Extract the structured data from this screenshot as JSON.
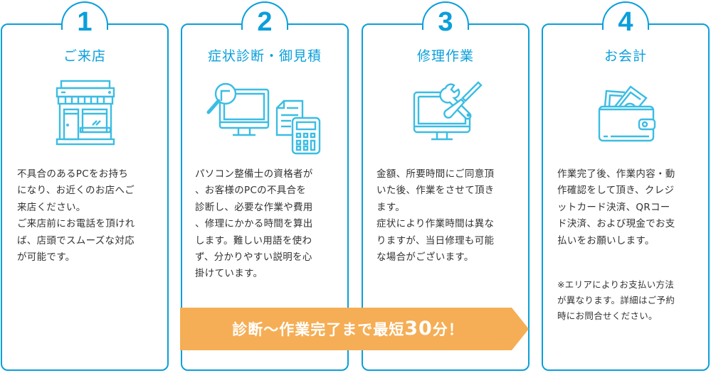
{
  "accent_color": "#0a9fdb",
  "banner_color": "#f5ae55",
  "steps": [
    {
      "number": "1",
      "title": "ご来店",
      "icon": "storefront-icon",
      "description": "不具合のあるPCをお持ち\nになり、お近くのお店へご\n来店ください。\nご来店前にお電話を頂けれ\nば、店頭でスムーズな対応\nが可能です。"
    },
    {
      "number": "2",
      "title": "症状診断・御見積",
      "icon": "diagnosis-estimate-icon",
      "description": "パソコン整備士の資格者が\n、お客様のPCの不具合を\n診断し、必要な作業や費用\n、修理にかかる時間を算出\nします。難しい用語を使わ\nず、分かりやすい説明を心\n掛けています。"
    },
    {
      "number": "3",
      "title": "修理作業",
      "icon": "monitor-tools-icon",
      "description": "金額、所要時間にご同意頂\nいた後、作業をさせて頂き\nます。\n症状により作業時間は異な\nりますが、当日修理も可能\nな場合がございます。"
    },
    {
      "number": "4",
      "title": "お会計",
      "icon": "wallet-icon",
      "description": "作業完了後、作業内容・動\n作確認をして頂き、クレジ\nットカード決済、QRコー\nド決済、および現金でお支\n払いをお願いします。",
      "note": "※エリアによりお支払い方法\nが異なります。詳細はご予約\n時にお問合せください。"
    }
  ],
  "banner": {
    "prefix": "診断〜作業完了まで最短",
    "highlight": "30",
    "suffix": "分！"
  }
}
